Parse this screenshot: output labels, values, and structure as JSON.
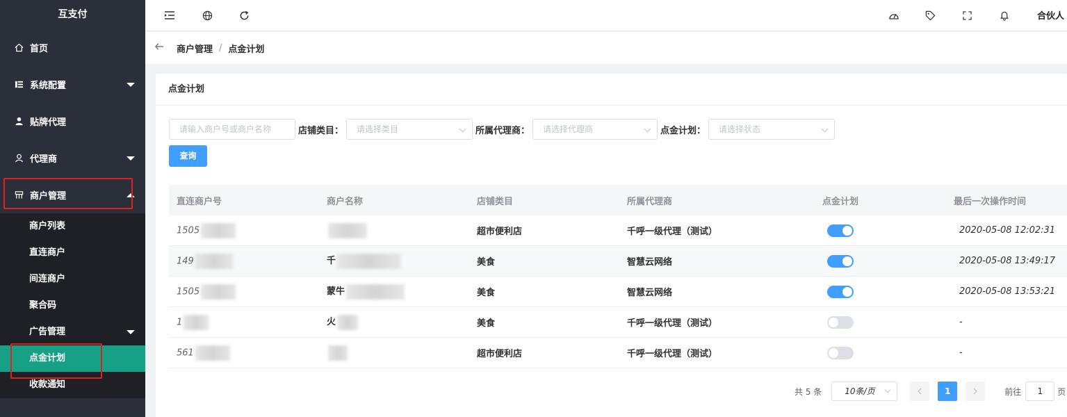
{
  "app": {
    "title": "互支付"
  },
  "sidebar": {
    "items": [
      {
        "label": "首页"
      },
      {
        "label": "系统配置"
      },
      {
        "label": "贴牌代理"
      },
      {
        "label": "代理商"
      },
      {
        "label": "商户管理"
      }
    ],
    "submenu": [
      {
        "label": "商户列表"
      },
      {
        "label": "直连商户"
      },
      {
        "label": "间连商户"
      },
      {
        "label": "聚合码"
      },
      {
        "label": "广告管理"
      },
      {
        "label": "点金计划"
      },
      {
        "label": "收款通知"
      }
    ]
  },
  "header": {
    "icons": [
      "menu-fold-icon",
      "globe-icon",
      "refresh-icon",
      "dashboard-icon",
      "tag-icon",
      "fullscreen-icon",
      "bell-icon"
    ],
    "user": "合伙人"
  },
  "breadcrumb": {
    "parent": "商户管理",
    "separator": "/",
    "current": "点金计划"
  },
  "card": {
    "title": "点金计划"
  },
  "filters": {
    "merchant_placeholder": "请输入商户号或商户名称",
    "category_label": "店铺类目：",
    "category_placeholder": "请选择类目",
    "agent_label": "所属代理商：",
    "agent_placeholder": "请选择代理商",
    "plan_label": "点金计划：",
    "plan_placeholder": "请选择状态",
    "query_button": "查询"
  },
  "table": {
    "columns": [
      "直连商户号",
      "商户名称",
      "店铺类目",
      "所属代理商",
      "点金计划",
      "最后一次操作时间"
    ],
    "rows": [
      {
        "id": "1505",
        "name": "",
        "category": "超市便利店",
        "agent": "千呼一级代理（测试）",
        "plan": true,
        "time": "2020-05-08 12:02:31"
      },
      {
        "id": "149",
        "name": "千",
        "category": "美食",
        "agent": "智慧云网络",
        "plan": true,
        "time": "2020-05-08 13:49:17"
      },
      {
        "id": "1505",
        "name": "蒙牛",
        "category": "美食",
        "agent": "智慧云网络",
        "plan": true,
        "time": "2020-05-08 13:53:21"
      },
      {
        "id": "1",
        "name": "火",
        "category": "美食",
        "agent": "千呼一级代理（测试）",
        "plan": false,
        "time": "-"
      },
      {
        "id": "561",
        "name": "",
        "category": "超市便利店",
        "agent": "千呼一级代理（测试）",
        "plan": false,
        "time": "-"
      }
    ]
  },
  "pagination": {
    "total": "共 5 条",
    "page_size": "10条/页",
    "current_page": "1",
    "goto_label": "前往",
    "goto_value": "1",
    "goto_suffix": "页"
  }
}
